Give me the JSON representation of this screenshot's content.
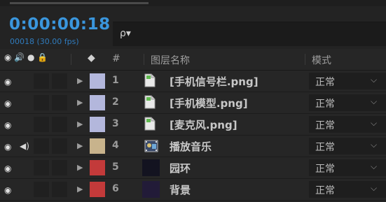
{
  "timeline": {
    "timecode": "0:00:00:18",
    "frames_info": "00018 (30.00 fps)"
  },
  "search": {
    "icon": "search-dropdown-icon",
    "glyph": "ρ▾"
  },
  "columns": {
    "switch_icons": "◉ 🔊 ● 🔒",
    "label_icon": "tag-icon",
    "label_glyph": "◆",
    "number": "#",
    "layer_name": "图层名称",
    "mode": "模式"
  },
  "layers": [
    {
      "num": "1",
      "name": "[手机信号栏.png]",
      "label_color": "#b3b7dc",
      "audio": false,
      "thumb": "png-file-icon",
      "mode": "正常"
    },
    {
      "num": "2",
      "name": "[手机模型.png]",
      "label_color": "#b3b7dc",
      "audio": false,
      "thumb": "png-file-icon",
      "mode": "正常"
    },
    {
      "num": "3",
      "name": "[麦克风.png]",
      "label_color": "#b3b7dc",
      "audio": false,
      "thumb": "png-file-icon",
      "mode": "正常"
    },
    {
      "num": "4",
      "name": "播放音乐",
      "label_color": "#c8b38c",
      "audio": true,
      "thumb": "precomp-icon",
      "mode": "正常"
    },
    {
      "num": "5",
      "name": "园环",
      "label_color": "#c33a3a",
      "audio": false,
      "thumb": "solid-dark",
      "mode": "正常"
    },
    {
      "num": "6",
      "name": "背景",
      "label_color": "#c33a3a",
      "audio": false,
      "thumb": "solid-purple",
      "mode": "正常"
    }
  ],
  "glyphs": {
    "eye": "◉",
    "speaker": "◀)",
    "expand": "▶",
    "chevron": "⌵"
  }
}
